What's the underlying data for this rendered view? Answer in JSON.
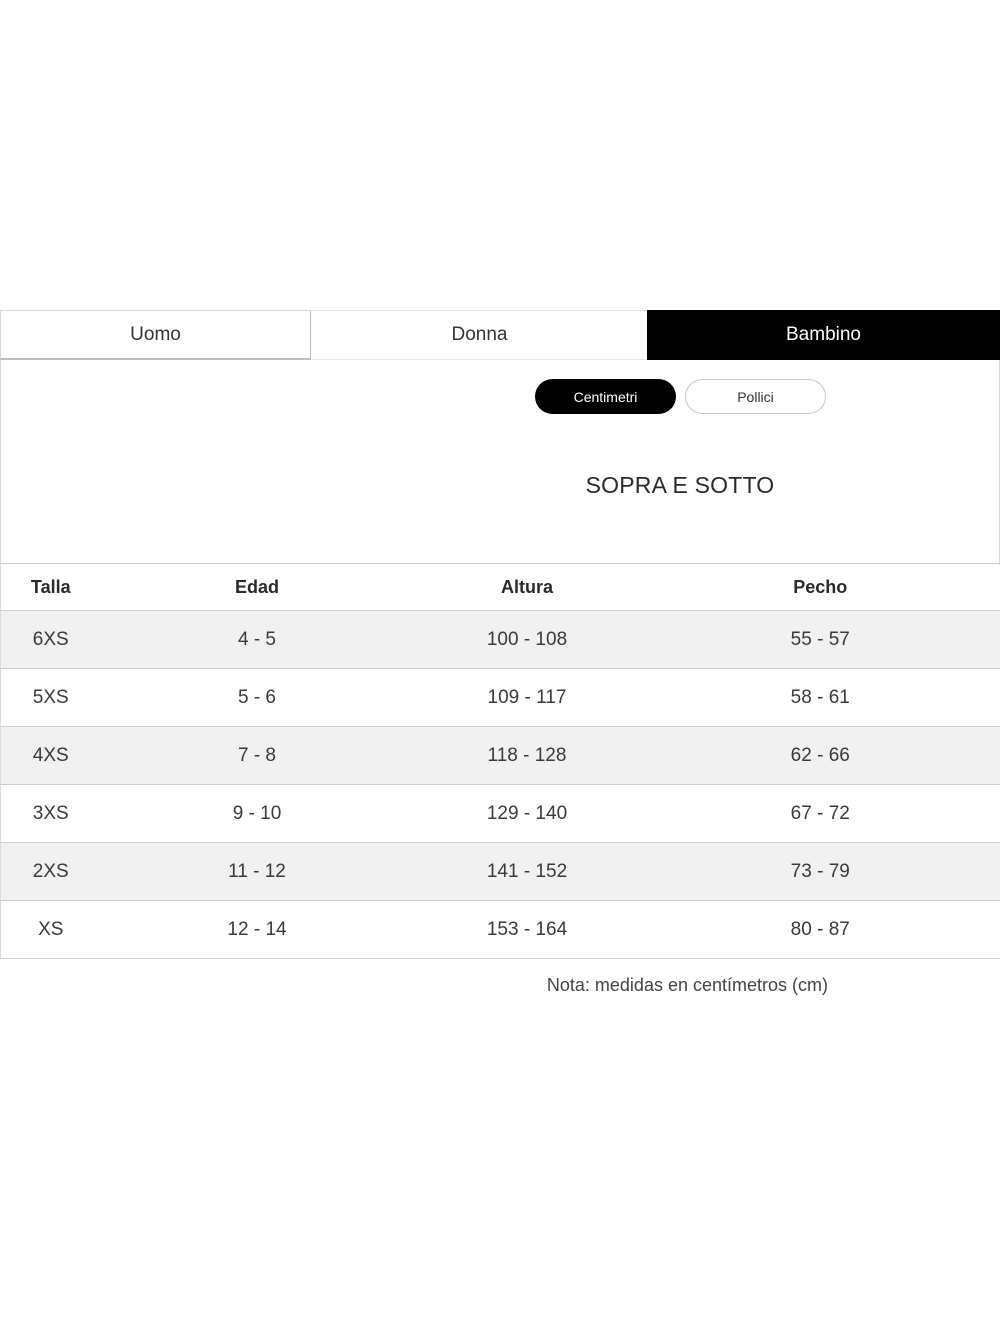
{
  "tabs": [
    {
      "label": "Uomo",
      "active": false
    },
    {
      "label": "Donna",
      "active": false
    },
    {
      "label": "Bambino",
      "active": true
    }
  ],
  "units": {
    "centimeters_label": "Centimetri",
    "inches_label": "Pollici",
    "selected": "Centimetri"
  },
  "section_title": "SOPRA E SOTTO",
  "table": {
    "headers": [
      "Talla",
      "Edad",
      "Altura",
      "Pecho"
    ],
    "rows": [
      [
        "6XS",
        "4 - 5",
        "100 - 108",
        "55 - 57"
      ],
      [
        "5XS",
        "5 - 6",
        "109 - 117",
        "58 - 61"
      ],
      [
        "4XS",
        "7 - 8",
        "118 - 128",
        "62 - 66"
      ],
      [
        "3XS",
        "9 - 10",
        "129 - 140",
        "67 - 72"
      ],
      [
        "2XS",
        "11 - 12",
        "141 - 152",
        "73 - 79"
      ],
      [
        "XS",
        "12 - 14",
        "153 - 164",
        "80 - 87"
      ]
    ]
  },
  "note": "Nota: medidas en centímetros (cm)",
  "colors": {
    "active_tab_bg": "#000000",
    "active_tab_text": "#ffffff",
    "row_shade": "#f1f1f1"
  }
}
